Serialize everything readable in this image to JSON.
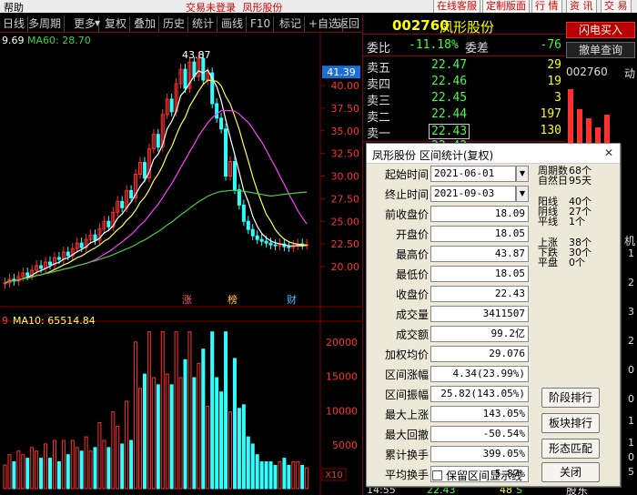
{
  "titlebar": {
    "menu": "帮助",
    "login": "交易未登录",
    "stock": "凤形股份",
    "buttons": [
      "在线客服",
      "定制版面",
      "行 情",
      "资 讯",
      "交 易"
    ]
  },
  "toolbar": {
    "items": [
      "日线",
      "多周期",
      "更多",
      "复权",
      "叠加",
      "历史",
      "统计",
      "画线",
      "F10",
      "标记",
      "+自选",
      "返回"
    ]
  },
  "chart": {
    "ma_header": {
      "ma_prev": "9.69",
      "ma60_label": "MA60:",
      "ma60_value": "28.70"
    },
    "peak_label": "43.87",
    "price_axis": [
      "40.00",
      "37.50",
      "35.00",
      "32.50",
      "30.00",
      "27.50",
      "25.00",
      "22.50",
      "20.00"
    ],
    "current_price_tag": "41.39",
    "markers": {
      "zhang": "涨",
      "bang": "榜",
      "cai": "财"
    },
    "volume_header": {
      "prefix": "9",
      "ma10_label": "MA10:",
      "ma10_value": "65514.84"
    },
    "volume_axis": [
      "20000",
      "15000",
      "10000",
      "5000"
    ],
    "volume_unit": "X10",
    "time_label": "14:55"
  },
  "quote": {
    "code": "002760",
    "name": "凤形股份",
    "weibi_label": "委比",
    "weibi_value": "-11.18%",
    "weicha_label": "委差",
    "weicha_value": "-76",
    "asks": [
      {
        "label": "卖五",
        "price": "22.47",
        "vol": "29"
      },
      {
        "label": "卖四",
        "price": "22.46",
        "vol": "19"
      },
      {
        "label": "卖三",
        "price": "22.45",
        "vol": "3"
      },
      {
        "label": "卖二",
        "price": "22.44",
        "vol": "197"
      },
      {
        "label": "卖一",
        "price": "22.43",
        "vol": "130"
      }
    ],
    "bid1": {
      "label": "买一",
      "price": "22.42",
      "vol": ""
    },
    "footer": {
      "time": "14:55",
      "price": "22.43",
      "vol": "48",
      "flag": "S"
    }
  },
  "right_panel": {
    "flash_buy": "闪电买入",
    "cancel_query": "撤单查询",
    "code": "002760",
    "dong": "动",
    "ji": "机",
    "gu": "股东",
    "volume_markers": [
      "1",
      "2",
      "3",
      "2",
      "0",
      "0",
      "1",
      "1",
      "0",
      "5"
    ]
  },
  "dialog": {
    "title": "凤形股份 区间统计(复权)",
    "close": "✕",
    "fields": [
      {
        "label": "起始时间",
        "value": "2021-06-01"
      },
      {
        "label": "终止时间",
        "value": "2021-09-03"
      },
      {
        "label": "前收盘价",
        "value": "18.09"
      },
      {
        "label": "开盘价",
        "value": "18.05"
      },
      {
        "label": "最高价",
        "value": "43.87"
      },
      {
        "label": "最低价",
        "value": "18.05"
      },
      {
        "label": "收盘价",
        "value": "22.43"
      },
      {
        "label": "成交量",
        "value": "3411507"
      },
      {
        "label": "成交额",
        "value": "99.2亿"
      },
      {
        "label": "加权均价",
        "value": "29.076"
      },
      {
        "label": "区间涨幅",
        "value": "4.34(23.99%)"
      },
      {
        "label": "区间振幅",
        "value": "25.82(143.05%)"
      },
      {
        "label": "最大上涨",
        "value": "143.05%"
      },
      {
        "label": "最大回撤",
        "value": "-50.54%"
      },
      {
        "label": "累计换手",
        "value": "399.05%"
      },
      {
        "label": "平均换手",
        "value": "5.87%"
      }
    ],
    "stats": {
      "zhouqi_label": "周期数",
      "zhouqi_value": "68个",
      "ziran_label": "自然日",
      "ziran_value": "95天",
      "yang_label": "阳线",
      "yang_value": "40个",
      "yin_label": "阴线",
      "yin_value": "27个",
      "ping_label": "平线",
      "ping_value": "1个",
      "up_label": "上涨",
      "up_value": "38个",
      "down_label": "下跌",
      "down_value": "30个",
      "flat_label": "平盘",
      "flat_value": "0个"
    },
    "buttons": {
      "stage": "阶段排行",
      "sector": "板块排行",
      "pattern": "形态匹配",
      "close": "关闭"
    },
    "checkbox": "保留区间显示线"
  },
  "colors": {
    "up": "#ff3030",
    "down": "#30ffff",
    "ma5": "#ffffff",
    "ma10": "#ffff40",
    "ma20": "#ff40ff",
    "ma60": "#40d040",
    "grid": "#800000",
    "dialog_bg": "#ece9d8"
  }
}
